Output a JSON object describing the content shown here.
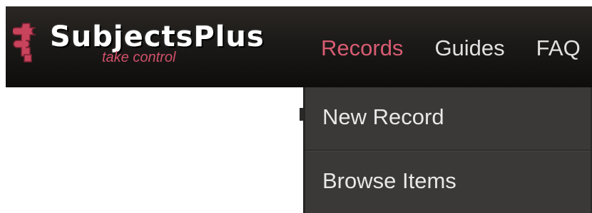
{
  "brand": {
    "name": "SubjectsPlus",
    "tagline": "take control",
    "icon": "puzzle-piece-icon",
    "colors": {
      "accent": "#d85c72",
      "bar": "#1c1a18",
      "menu": "#3a3938"
    }
  },
  "nav": {
    "items": [
      {
        "label": "Records",
        "active": true
      },
      {
        "label": "Guides",
        "active": false
      },
      {
        "label": "FAQ",
        "active": false
      }
    ]
  },
  "dropdown": {
    "items": [
      {
        "label": "New Record"
      },
      {
        "label": "Browse Items"
      }
    ]
  }
}
